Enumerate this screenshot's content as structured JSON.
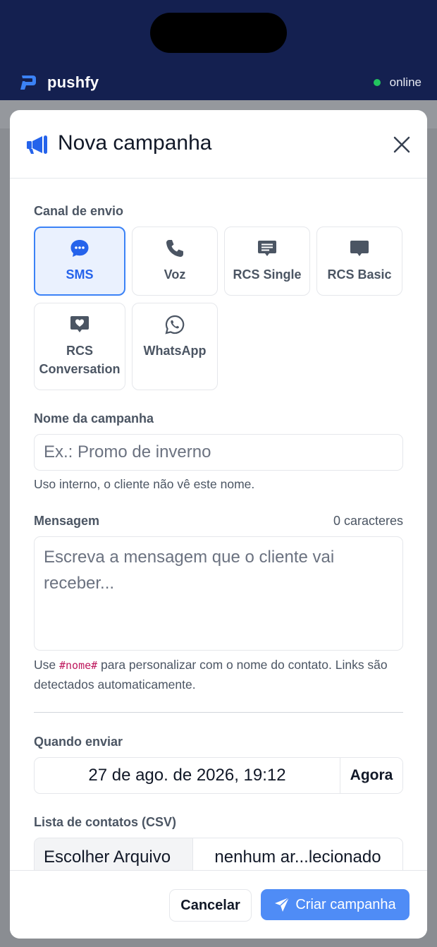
{
  "app": {
    "brand_name": "pushfy",
    "status_text": "online",
    "status_color": "#22c55e",
    "accent_color": "#3b82f6"
  },
  "modal": {
    "title": "Nova campanha",
    "title_icon": "megaphone-icon",
    "close_icon": "close-icon"
  },
  "channel_section": {
    "label": "Canal de envio",
    "selected": "SMS",
    "channels": [
      {
        "label": "SMS",
        "icon": "chat-bubble-icon"
      },
      {
        "label": "Voz",
        "icon": "phone-icon"
      },
      {
        "label": "RCS Single",
        "icon": "message-lines-icon"
      },
      {
        "label": "RCS Basic",
        "icon": "message-square-icon"
      },
      {
        "label": "RCS Conversation",
        "icon": "message-heart-icon"
      },
      {
        "label": "WhatsApp",
        "icon": "whatsapp-icon"
      }
    ]
  },
  "campaign_name": {
    "label": "Nome da campanha",
    "value": "",
    "placeholder": "Ex.: Promo de inverno",
    "hint": "Uso interno, o cliente não vê este nome."
  },
  "message": {
    "label": "Mensagem",
    "counter": "0 caracteres",
    "value": "",
    "placeholder": "Escreva a mensagem que o cliente vai receber...",
    "hint_prefix": "Use ",
    "hint_code": "#nome#",
    "hint_suffix": " para personalizar com o nome do contato. Links são detectados automaticamente."
  },
  "schedule": {
    "label": "Quando enviar",
    "value": "27 de ago. de 2026, 19:12",
    "now_label": "Agora"
  },
  "contacts": {
    "label": "Lista de contatos (CSV)",
    "choose_label": "Escolher Arquivo",
    "file_status": "nenhum ar...lecionado"
  },
  "footer": {
    "cancel_label": "Cancelar",
    "create_label": "Criar campanha",
    "create_icon": "send-icon"
  }
}
